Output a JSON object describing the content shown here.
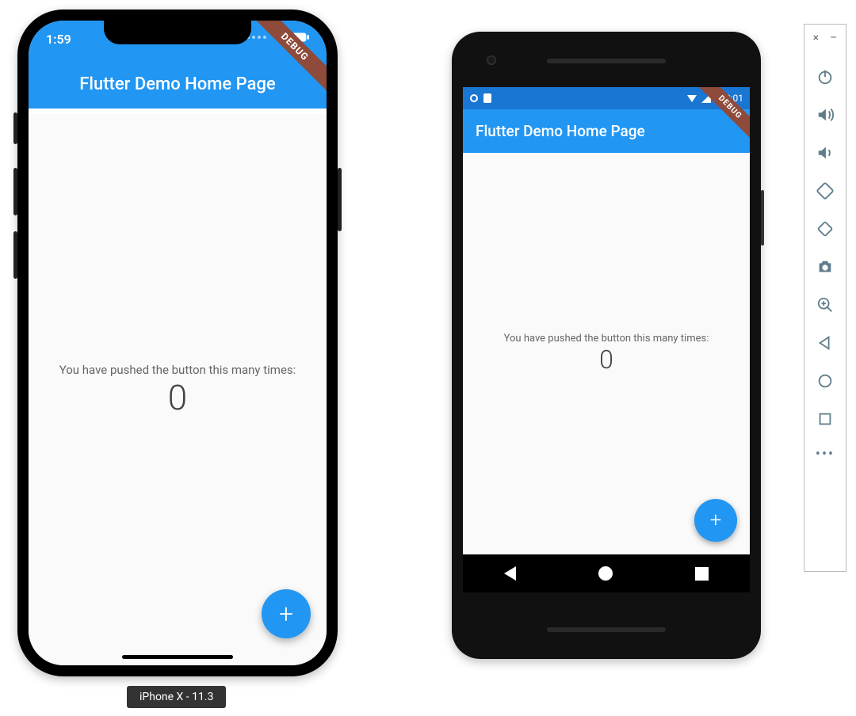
{
  "colors": {
    "primary": "#2196f3",
    "primaryDark": "#1976d2",
    "debugBanner": "#8e4a3a"
  },
  "debug_banner_label": "DEBUG",
  "iphone": {
    "status": {
      "time": "1:59"
    },
    "appbar": {
      "title": "Flutter Demo Home Page"
    },
    "body": {
      "label": "You have pushed the button this many times:",
      "counter": "0"
    },
    "caption": "iPhone X - 11.3"
  },
  "android": {
    "status": {
      "time": "2:01"
    },
    "appbar": {
      "title": "Flutter Demo Home Page"
    },
    "body": {
      "label": "You have pushed the button this many times:",
      "counter": "0"
    }
  },
  "emulator_sidebar": {
    "close": "×",
    "minimize": "–",
    "more": "•••"
  }
}
